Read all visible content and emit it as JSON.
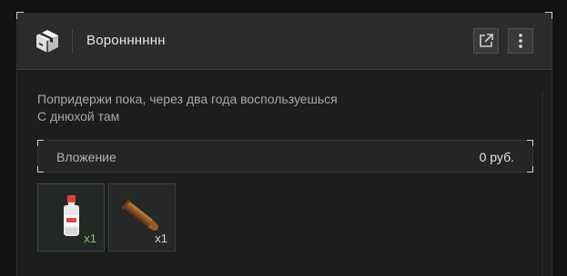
{
  "header": {
    "title": "Воронннннн",
    "icon": "package-box-icon",
    "actions": [
      {
        "name": "open-external-icon"
      },
      {
        "name": "more-vertical-icon"
      }
    ]
  },
  "message": {
    "line1": "Попридержи пока, через два года воспользуешься",
    "line2": "С днюхой там"
  },
  "investment": {
    "label": "Вложение",
    "value": "0 руб."
  },
  "items": [
    {
      "icon": "medicine-bottle-icon",
      "qty": "x1",
      "qty_color": "#7fcf6a"
    },
    {
      "icon": "bullet-cartridge-icon",
      "qty": "x1",
      "qty_color": "#d8d8d8"
    }
  ],
  "colors": {
    "background": "#121212",
    "panel": "#1d1d1e",
    "header": "#2b2b2c",
    "accent_green": "#7fcf6a"
  }
}
